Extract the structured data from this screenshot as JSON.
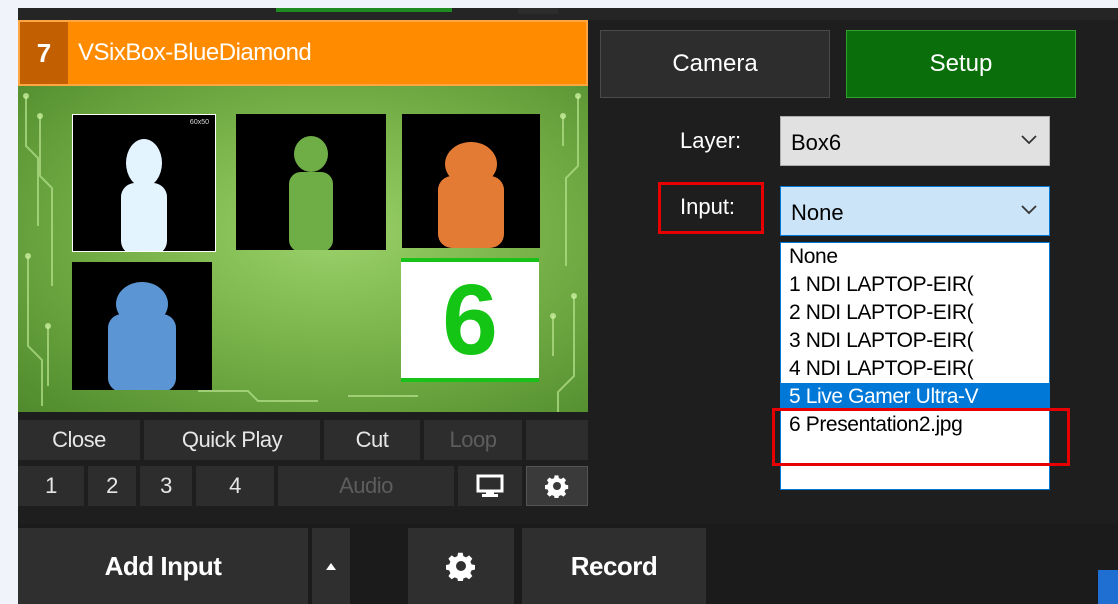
{
  "input": {
    "number": "7",
    "title": "VSixBox-BlueDiamond",
    "tile_label": "60x50",
    "number_six": "6"
  },
  "controls": {
    "row1": [
      "Close",
      "Quick Play",
      "Cut",
      "Loop"
    ],
    "row2": [
      "1",
      "2",
      "3",
      "4",
      "Audio"
    ],
    "icons": [
      "monitor-icon",
      "gear-icon"
    ]
  },
  "side_panel": {
    "camera_label": "Camera",
    "setup_label": "Setup",
    "layer_label": "Layer:",
    "layer_value": "Box6",
    "input_label": "Input:",
    "input_value": "None"
  },
  "dropdown": {
    "options": [
      "None",
      "1 NDI LAPTOP-EIR(",
      "2 NDI LAPTOP-EIR(",
      "3 NDI LAPTOP-EIR(",
      "4 NDI LAPTOP-EIR(",
      "5 Live Gamer Ultra-V",
      "6 Presentation2.jpg"
    ],
    "selected_index": 5
  },
  "bottom_bar": {
    "add_input_label": "Add Input",
    "record_label": "Record",
    "icons": [
      "caret-up-icon",
      "gear-icon"
    ]
  },
  "colors": {
    "header_orange": "#ff8c00",
    "setup_green": "#0a6e0a",
    "highlight_red": "#e80000",
    "selection_blue": "#0078d7"
  }
}
